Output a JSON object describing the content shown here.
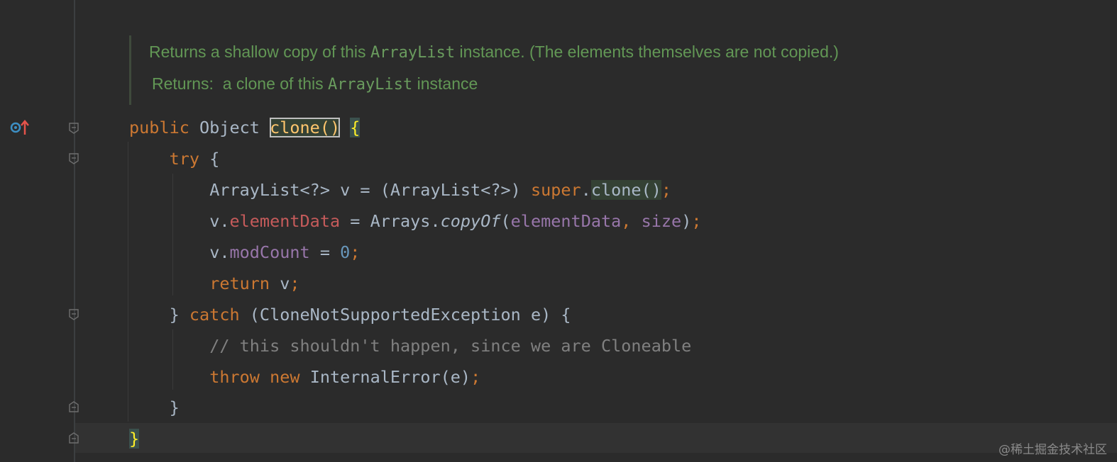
{
  "doc": {
    "line1_pre": "Returns a shallow copy of this ",
    "line1_code": "ArrayList",
    "line1_post": " instance. (The elements themselves are not copied.)",
    "line2_pre": "Returns:  a clone of this ",
    "line2_code": "ArrayList",
    "line2_post": " instance"
  },
  "code": {
    "l1": {
      "public": "public",
      "type": " Object ",
      "method": "clone()",
      "space": " ",
      "brace": "{"
    },
    "l2": {
      "indent": "    ",
      "kw": "try",
      "rest": " {"
    },
    "l3": {
      "indent": "        ",
      "decl": "ArrayList<?> v = (ArrayList<?>) ",
      "super": "super",
      "dot": ".",
      "call": "clone()",
      "semi": ";"
    },
    "l4": {
      "indent": "        ",
      "v": "v.",
      "field": "elementData",
      "eq": " = Arrays.",
      "method": "copyOf",
      "open": "(",
      "arg1": "elementData",
      "comma": ", ",
      "arg2": "size",
      "close": ")",
      "semi": ";"
    },
    "l5": {
      "indent": "        ",
      "v": "v.",
      "field": "modCount",
      "eq": " = ",
      "num": "0",
      "semi": ";"
    },
    "l6": {
      "indent": "        ",
      "kw": "return",
      "rest": " v",
      "semi": ";"
    },
    "l7": {
      "indent": "    ",
      "close": "} ",
      "kw": "catch",
      "rest": " (CloneNotSupportedException e) {"
    },
    "l8": {
      "indent": "        ",
      "comment": "// this shouldn't happen, since we are Cloneable"
    },
    "l9": {
      "indent": "        ",
      "kw1": "throw",
      "sp": " ",
      "kw2": "new",
      "rest": " InternalError(e)",
      "semi": ";"
    },
    "l10": {
      "indent": "    ",
      "close": "}"
    },
    "l11": {
      "close": "}"
    }
  },
  "gutter": {
    "icon": "override-method-icon",
    "icon_color": "#3d8fc4",
    "arrow_color": "#e5534b"
  },
  "watermark": "@稀土掘金技术社区",
  "colors": {
    "background": "#2b2b2b",
    "keyword": "#cc7832",
    "doc_comment": "#629755",
    "field": "#9876aa",
    "field_red": "#c65b5b",
    "number": "#6897bb",
    "comment": "#808080",
    "default_text": "#a9b7c6"
  }
}
